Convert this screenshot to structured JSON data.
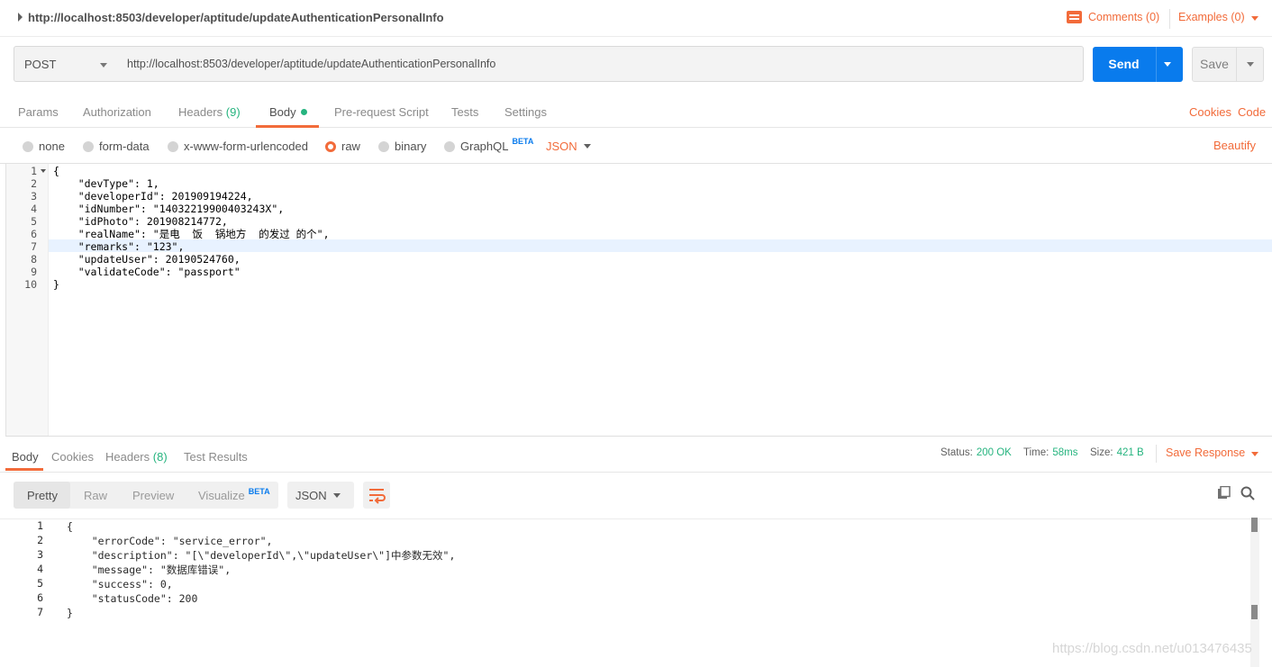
{
  "titlebar": {
    "title": "http://localhost:8503/developer/aptitude/updateAuthenticationPersonalInfo",
    "comments": "Comments (0)",
    "examples": "Examples (0)"
  },
  "request": {
    "method": "POST",
    "url": "http://localhost:8503/developer/aptitude/updateAuthenticationPersonalInfo",
    "send_label": "Send",
    "save_label": "Save"
  },
  "request_tabs": {
    "params": "Params",
    "authorization": "Authorization",
    "headers": "Headers",
    "headers_count": "(9)",
    "body": "Body",
    "prerequest": "Pre-request Script",
    "tests": "Tests",
    "settings": "Settings",
    "cookies": "Cookies",
    "code": "Code"
  },
  "body_modes": {
    "none": "none",
    "form_data": "form-data",
    "urlencoded": "x-www-form-urlencoded",
    "raw": "raw",
    "binary": "binary",
    "graphql": "GraphQL",
    "beta": "BETA",
    "format": "JSON",
    "beautify": "Beautify",
    "selected": "raw"
  },
  "request_body": {
    "line_numbers": [
      "1",
      "2",
      "3",
      "4",
      "5",
      "6",
      "7",
      "8",
      "9",
      "10"
    ],
    "lines": [
      "{",
      "    \"devType\": 1,",
      "    \"developerId\": 201909194224,",
      "    \"idNumber\": \"14032219900403243X\",",
      "    \"idPhoto\": 201908214772,",
      "    \"realName\": \"是电  饭  锅地方  的发过 的个\",",
      "    \"remarks\": \"123\",",
      "    \"updateUser\": 20190524760,",
      "    \"validateCode\": \"passport\"",
      "}"
    ]
  },
  "response_tabs": {
    "body": "Body",
    "cookies": "Cookies",
    "headers": "Headers",
    "headers_count": "(8)",
    "test_results": "Test Results"
  },
  "response_status": {
    "status_label": "Status:",
    "status_value": "200 OK",
    "time_label": "Time:",
    "time_value": "58ms",
    "size_label": "Size:",
    "size_value": "421 B",
    "save_response": "Save Response"
  },
  "response_view": {
    "pretty": "Pretty",
    "raw": "Raw",
    "preview": "Preview",
    "visualize": "Visualize",
    "beta": "BETA",
    "format": "JSON"
  },
  "response_body": {
    "line_numbers": [
      "1",
      "2",
      "3",
      "4",
      "5",
      "6",
      "7"
    ],
    "lines": [
      "{",
      "    \"errorCode\": \"service_error\",",
      "    \"description\": \"[\\\"developerId\\\",\\\"updateUser\\\"]中参数无效\",",
      "    \"message\": \"数据库错误\",",
      "    \"success\": 0,",
      "    \"statusCode\": 200",
      "}"
    ]
  },
  "watermark": "https://blog.csdn.net/u013476435",
  "colors": {
    "accent": "#f26b3a",
    "send_blue": "#097bed",
    "status_green": "#26b47f"
  }
}
